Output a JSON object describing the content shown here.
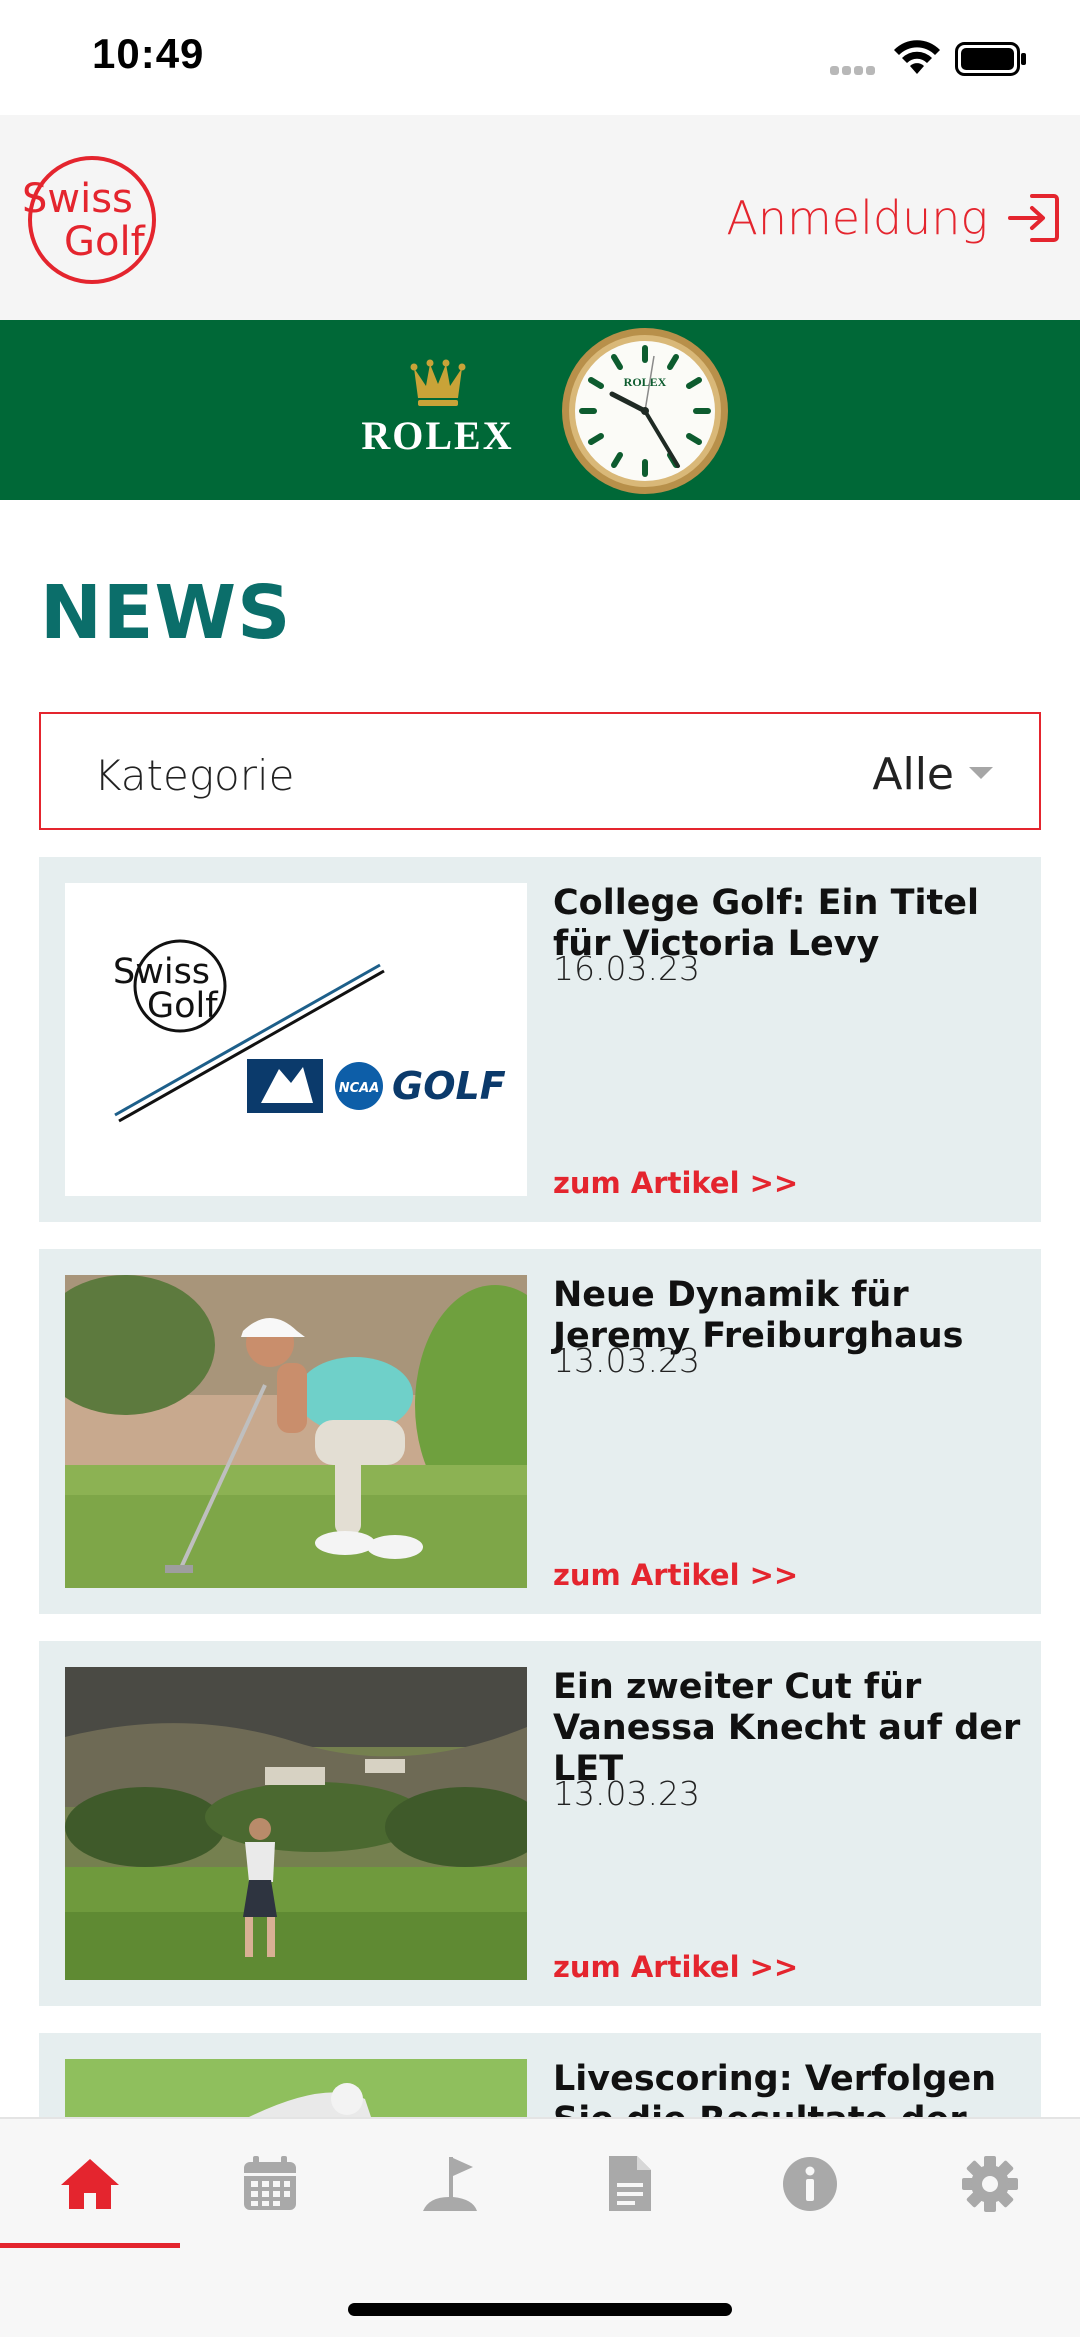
{
  "status_bar": {
    "time": "10:49"
  },
  "header": {
    "logo_text_line1": "Swiss",
    "logo_text_line2": "Golf",
    "login_label": "Anmeldung"
  },
  "sponsor": {
    "brand": "ROLEX",
    "dial_text": "ROLEX",
    "color": "#006837"
  },
  "page": {
    "title": "NEWS"
  },
  "filter": {
    "label": "Kategorie",
    "value": "Alle"
  },
  "news": [
    {
      "title": "College Golf: Ein Titel für Victoria Levy",
      "date": "16.03.23",
      "link": "zum Artikel >>",
      "thumb": "swissgolf-ncaa-logo"
    },
    {
      "title": "Neue Dynamik für Jeremy Freiburghaus",
      "date": "13.03.23",
      "link": "zum Artikel >>",
      "thumb": "golfer-crouching-putt"
    },
    {
      "title": "Ein zweiter Cut für Vanessa Knecht auf der LET",
      "date": "13.03.23",
      "link": "zum Artikel >>",
      "thumb": "golfer-on-course"
    },
    {
      "title": "Livescoring: Verfolgen Sie die Resultate der",
      "date": "",
      "link": "",
      "thumb": "golfer-swing"
    }
  ],
  "thumb_texts": {
    "ncaa_badge": "NCAA",
    "ncaa_golf": "GOLF"
  },
  "tabs": [
    {
      "name": "home",
      "icon": "home-icon",
      "active": true
    },
    {
      "name": "calendar",
      "icon": "calendar-icon",
      "active": false
    },
    {
      "name": "golf-course",
      "icon": "flag-icon",
      "active": false
    },
    {
      "name": "documents",
      "icon": "document-icon",
      "active": false
    },
    {
      "name": "info",
      "icon": "info-icon",
      "active": false
    },
    {
      "name": "settings",
      "icon": "gear-icon",
      "active": false
    }
  ],
  "colors": {
    "accent": "#e4252e",
    "title": "#0b6e6a",
    "card_bg": "#e6eeef",
    "tab_inactive": "#a9a9a9"
  }
}
